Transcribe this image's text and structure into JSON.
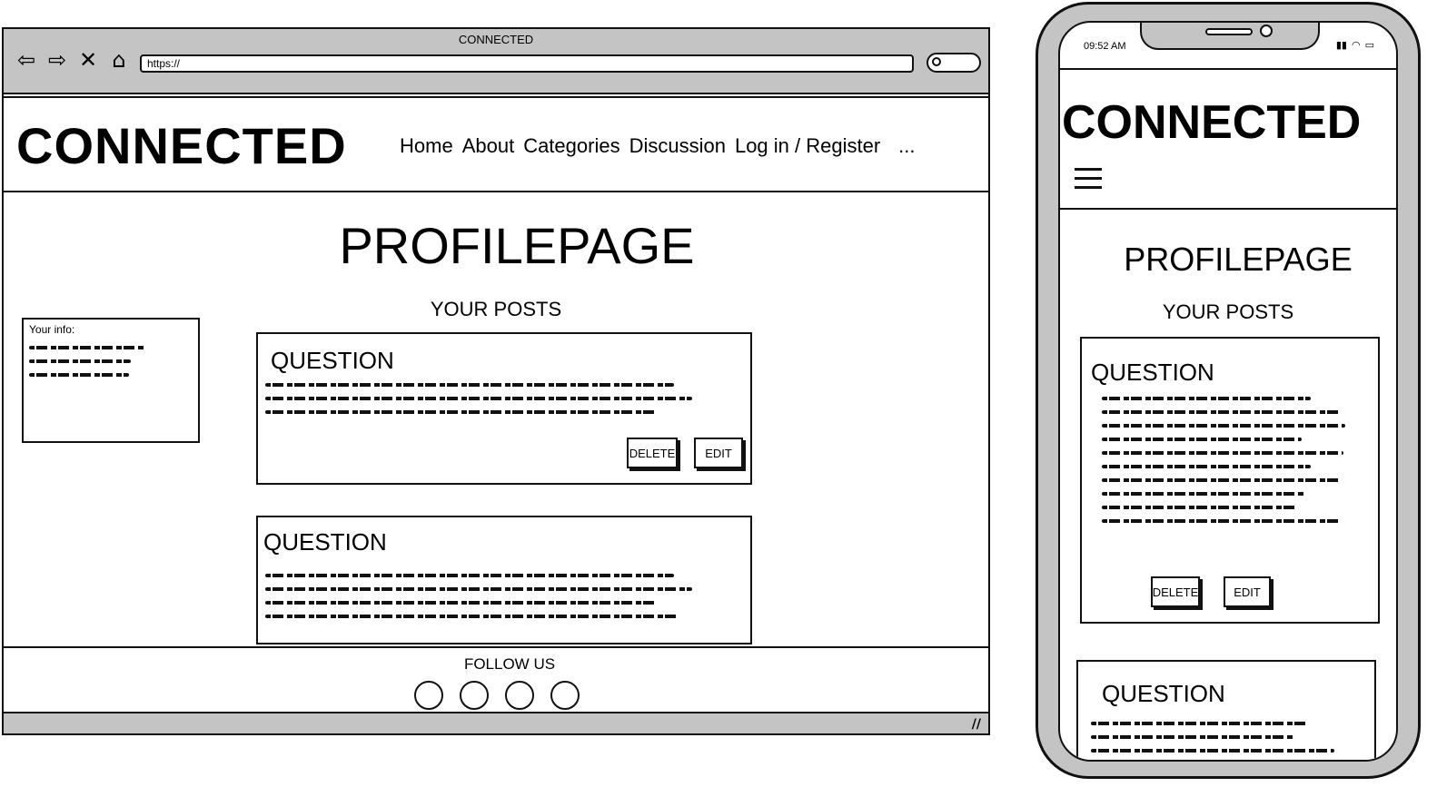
{
  "desktop": {
    "window_title": "CONNECTED",
    "url": "https://",
    "site_logo": "CONNECTED",
    "menu": {
      "home": "Home",
      "about": "About",
      "categories": "Categories",
      "discussion": "Discussion",
      "login": "Log in / Register",
      "more": "..."
    },
    "page_title": "PROFILEPAGE",
    "posts_heading": "YOUR POSTS",
    "info_label": "Your info:",
    "posts": [
      {
        "title": "QUESTION",
        "delete_label": "DELETE",
        "edit_label": "EDIT"
      },
      {
        "title": "QUESTION"
      }
    ],
    "footer": {
      "follow_label": "FOLLOW US"
    }
  },
  "mobile": {
    "status_time": "09:52 AM",
    "site_logo": "CONNECTED",
    "page_title": "PROFILEPAGE",
    "posts_heading": "YOUR POSTS",
    "posts": [
      {
        "title": "QUESTION",
        "delete_label": "DELETE",
        "edit_label": "EDIT"
      },
      {
        "title": "QUESTION"
      }
    ]
  },
  "icons": {
    "back": "back-arrow-icon",
    "forward": "forward-arrow-icon",
    "close": "close-icon",
    "home": "home-icon",
    "search": "search-icon",
    "menu": "hamburger-menu-icon",
    "signal": "signal-icon",
    "wifi": "wifi-icon",
    "battery": "battery-icon"
  },
  "colors": {
    "chrome": "#c4c4c4",
    "ink": "#111111",
    "background": "#ffffff"
  }
}
